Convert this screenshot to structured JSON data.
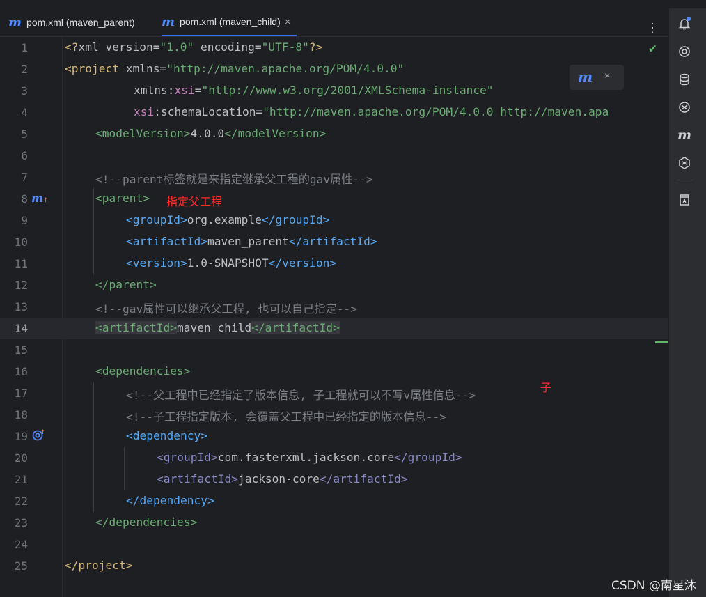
{
  "tabs": [
    {
      "label": "pom.xml (maven_parent)",
      "active": false
    },
    {
      "label": "pom.xml (maven_child)",
      "active": true,
      "close": "×"
    }
  ],
  "tab_icon": "m",
  "popup": {
    "icon": "maven-reload-icon",
    "close": "×"
  },
  "annotations": {
    "parent": "指定父工程",
    "child": "子"
  },
  "watermark": "CSDN @南星沐",
  "colors": {
    "background": "#1e1f22",
    "tag": "#d5b778",
    "string": "#6aab73",
    "comment": "#7a7e85",
    "accent": "#548af7",
    "annotation": "#ff2a2a"
  },
  "right_toolbar": [
    "notifications-icon",
    "ai-assistant-icon",
    "database-icon",
    "plugin-icon",
    "maven-icon",
    "gradle-icon",
    "readme-icon"
  ],
  "lines": [
    {
      "n": "1",
      "parts": [
        "<?",
        "xml",
        " version=",
        "\"1.0\"",
        " encoding=",
        "\"UTF-8\"",
        "?>"
      ]
    },
    {
      "n": "2",
      "parts": [
        "<project",
        " xmlns=",
        "\"http://maven.apache.org/POM/4.0.0\""
      ]
    },
    {
      "n": "3",
      "parts": [
        "xmlns:",
        "xsi",
        "=",
        "\"http://www.w3.org/2001/XMLSchema-instance\""
      ]
    },
    {
      "n": "4",
      "parts": [
        "xsi",
        ":schemaLocation=",
        "\"http://maven.apache.org/POM/4.0.0 http://maven.apa"
      ]
    },
    {
      "n": "5",
      "parts": [
        "<modelVersion>",
        "4.0.0",
        "</modelVersion>"
      ]
    },
    {
      "n": "6",
      "parts": []
    },
    {
      "n": "7",
      "parts": [
        "<!--parent标签就是来指定继承父工程的gav属性-->"
      ]
    },
    {
      "n": "8",
      "parts": [
        "<parent>"
      ]
    },
    {
      "n": "9",
      "parts": [
        "<groupId>",
        "org.example",
        "</groupId>"
      ]
    },
    {
      "n": "10",
      "parts": [
        "<artifactId>",
        "maven_parent",
        "</artifactId>"
      ]
    },
    {
      "n": "11",
      "parts": [
        "<version>",
        "1.0-SNAPSHOT",
        "</version>"
      ]
    },
    {
      "n": "12",
      "parts": [
        "</parent>"
      ]
    },
    {
      "n": "13",
      "parts": [
        "<!--gav属性可以继承父工程, 也可以自己指定-->"
      ]
    },
    {
      "n": "14",
      "parts": [
        "<artifactId>",
        "maven_child",
        "</artifactId>"
      ]
    },
    {
      "n": "15",
      "parts": []
    },
    {
      "n": "16",
      "parts": [
        "<dependencies>"
      ]
    },
    {
      "n": "17",
      "parts": [
        "<!--父工程中已经指定了版本信息, 子工程就可以不写v属性信息-->"
      ]
    },
    {
      "n": "18",
      "parts": [
        "<!--子工程指定版本, 会覆盖父工程中已经指定的版本信息-->"
      ]
    },
    {
      "n": "19",
      "parts": [
        "<dependency>"
      ]
    },
    {
      "n": "20",
      "parts": [
        "<groupId>",
        "com.fasterxml.jackson.core",
        "</groupId>"
      ]
    },
    {
      "n": "21",
      "parts": [
        "<artifactId>",
        "jackson-core",
        "</artifactId>"
      ]
    },
    {
      "n": "22",
      "parts": [
        "</dependency>"
      ]
    },
    {
      "n": "23",
      "parts": [
        "</dependencies>"
      ]
    },
    {
      "n": "24",
      "parts": []
    },
    {
      "n": "25",
      "parts": [
        "</project>"
      ]
    }
  ]
}
